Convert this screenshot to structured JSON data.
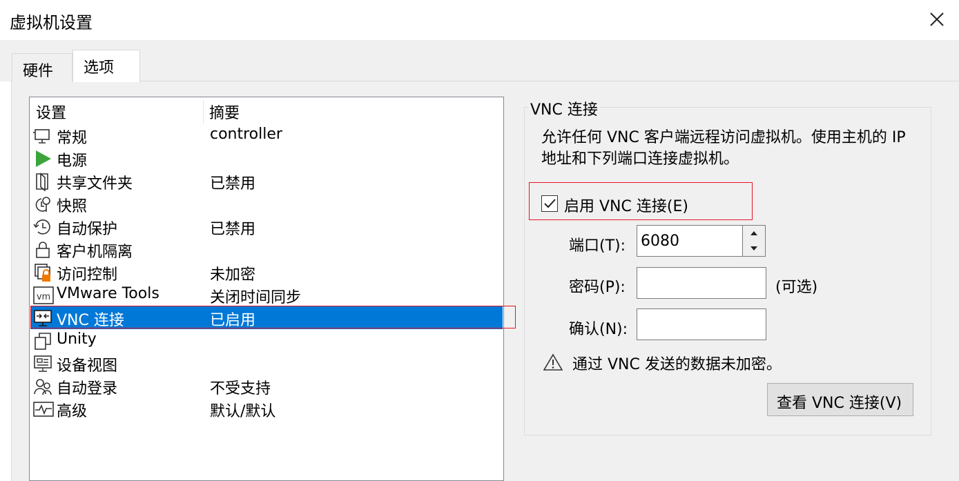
{
  "window": {
    "title": "虚拟机设置",
    "close_icon": "close-icon"
  },
  "tabs": [
    {
      "label": "硬件",
      "active": false
    },
    {
      "label": "选项",
      "active": true
    }
  ],
  "settings_list": {
    "columns": [
      "设置",
      "摘要"
    ],
    "rows": [
      {
        "name": "常规",
        "summary": "controller",
        "icon": "monitor-icon"
      },
      {
        "name": "电源",
        "summary": "",
        "icon": "play-icon"
      },
      {
        "name": "共享文件夹",
        "summary": "已禁用",
        "icon": "folder-icon"
      },
      {
        "name": "快照",
        "summary": "",
        "icon": "snapshot-icon"
      },
      {
        "name": "自动保护",
        "summary": "已禁用",
        "icon": "clock-icon"
      },
      {
        "name": "客户机隔离",
        "summary": "",
        "icon": "lock-icon"
      },
      {
        "name": "访问控制",
        "summary": "未加密",
        "icon": "access-control-icon"
      },
      {
        "name": "VMware Tools",
        "summary": "关闭时间同步",
        "icon": "vm-icon"
      },
      {
        "name": "VNC 连接",
        "summary": "已启用",
        "icon": "vnc-icon",
        "selected": true
      },
      {
        "name": "Unity",
        "summary": "",
        "icon": "unity-icon"
      },
      {
        "name": "设备视图",
        "summary": "",
        "icon": "device-view-icon"
      },
      {
        "name": "自动登录",
        "summary": "不受支持",
        "icon": "users-icon"
      },
      {
        "name": "高级",
        "summary": "默认/默认",
        "icon": "pulse-icon"
      }
    ]
  },
  "vnc": {
    "group_title": "VNC 连接",
    "description": "允许任何 VNC 客户端远程访问虚拟机。使用主机的 IP 地址和下列端口连接虚拟机。",
    "enable_label": "启用 VNC 连接(E)",
    "enabled": true,
    "port_label": "端口(T):",
    "port_value": "6080",
    "password_label": "密码(P):",
    "password_value": "",
    "optional_note": "(可选)",
    "confirm_label": "确认(N):",
    "confirm_value": "",
    "warning": "通过 VNC 发送的数据未加密。",
    "view_button": "查看 VNC 连接(V)"
  }
}
